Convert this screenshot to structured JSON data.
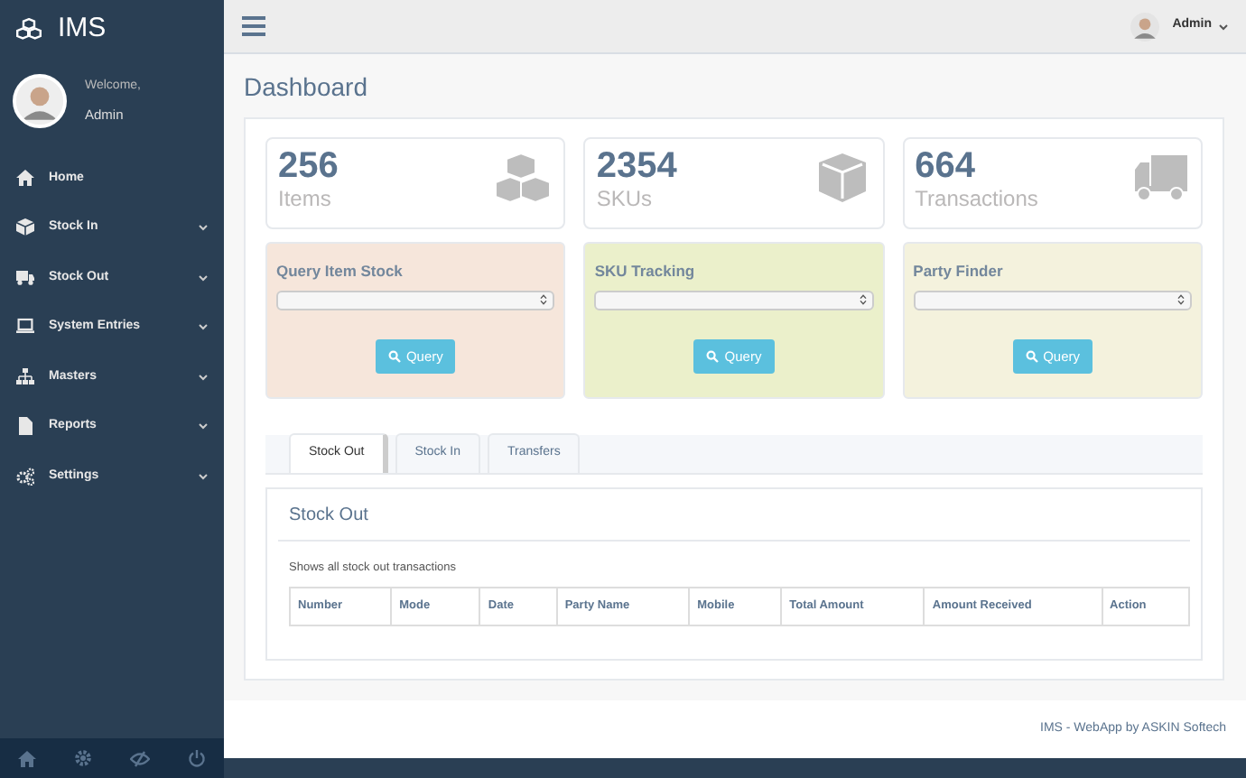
{
  "brand": {
    "title": "IMS"
  },
  "profile": {
    "greeting": "Welcome,",
    "name": "Admin"
  },
  "sidebar": {
    "items": [
      {
        "label": "Home",
        "expandable": false
      },
      {
        "label": "Stock In",
        "expandable": true
      },
      {
        "label": "Stock Out",
        "expandable": true
      },
      {
        "label": "System Entries",
        "expandable": true
      },
      {
        "label": "Masters",
        "expandable": true
      },
      {
        "label": "Reports",
        "expandable": true
      },
      {
        "label": "Settings",
        "expandable": true
      }
    ]
  },
  "topbar": {
    "user": "Admin"
  },
  "page_title": "Dashboard",
  "stats": [
    {
      "value": "256",
      "label": "Items"
    },
    {
      "value": "2354",
      "label": "SKUs"
    },
    {
      "value": "664",
      "label": "Transactions"
    }
  ],
  "query_cards": [
    {
      "title": "Query Item Stock",
      "button": "Query",
      "color": "#f6e6db"
    },
    {
      "title": "SKU Tracking",
      "button": "Query",
      "color": "#ebf0cb"
    },
    {
      "title": "Party Finder",
      "button": "Query",
      "color": "#f4f2dd"
    }
  ],
  "tabs": [
    {
      "label": "Stock Out",
      "selected": true
    },
    {
      "label": "Stock In",
      "selected": false
    },
    {
      "label": "Transfers",
      "selected": false
    }
  ],
  "panel": {
    "title": "Stock Out",
    "description": "Shows all stock out transactions"
  },
  "table": {
    "columns": [
      "Number",
      "Mode",
      "Date",
      "Party Name",
      "Mobile",
      "Total Amount",
      "Amount Received",
      "Action"
    ]
  },
  "footer": "IMS - WebApp by ASKIN Softech"
}
